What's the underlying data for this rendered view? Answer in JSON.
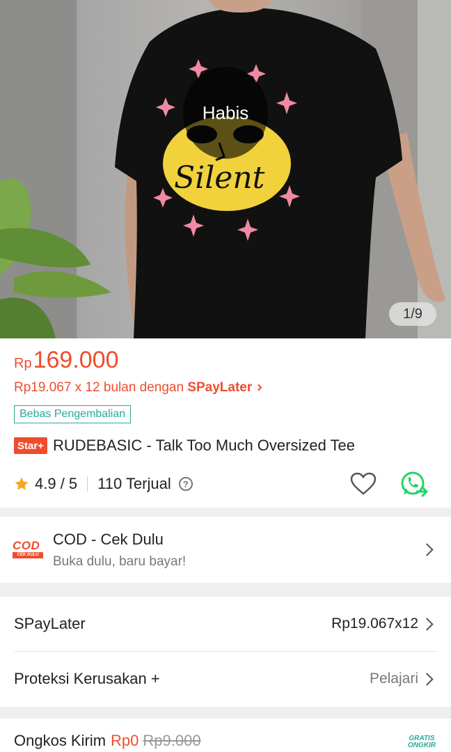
{
  "gallery": {
    "sold_out_label": "Habis",
    "counter": "1/9",
    "print_text": "Silent"
  },
  "product": {
    "price_currency": "Rp",
    "price_amount": "169.000",
    "installment_text": "Rp19.067 x 12 bulan dengan ",
    "installment_brand": "SPayLater",
    "return_tag": "Bebas Pengembalian",
    "star_badge": "Star+",
    "title": "RUDEBASIC - Talk Too Much Oversized Tee",
    "rating": "4.9 / 5",
    "sold": "110 Terjual",
    "help_glyph": "?"
  },
  "cod": {
    "logo_text": "COD",
    "logo_sub": "CEK DULU",
    "title": "COD - Cek Dulu",
    "subtitle": "Buka dulu, baru bayar!"
  },
  "options": [
    {
      "label": "SPayLater",
      "value": "Rp19.067x12"
    },
    {
      "label": "Proteksi Kerusakan +",
      "value": "Pelajari"
    }
  ],
  "shipping": {
    "label": "Ongkos Kirim",
    "free_price": "Rp0",
    "old_price": "Rp9.000",
    "badge_line1": "GRATIS",
    "badge_line2": "ONGKIR"
  },
  "colors": {
    "accent": "#ee4d2d",
    "teal": "#26aa99",
    "whatsapp": "#25d366",
    "star": "#f5a623"
  },
  "icons": [
    "star-icon",
    "help-icon",
    "heart-icon",
    "whatsapp-share-icon",
    "chevron-right-icon",
    "cod-logo"
  ]
}
